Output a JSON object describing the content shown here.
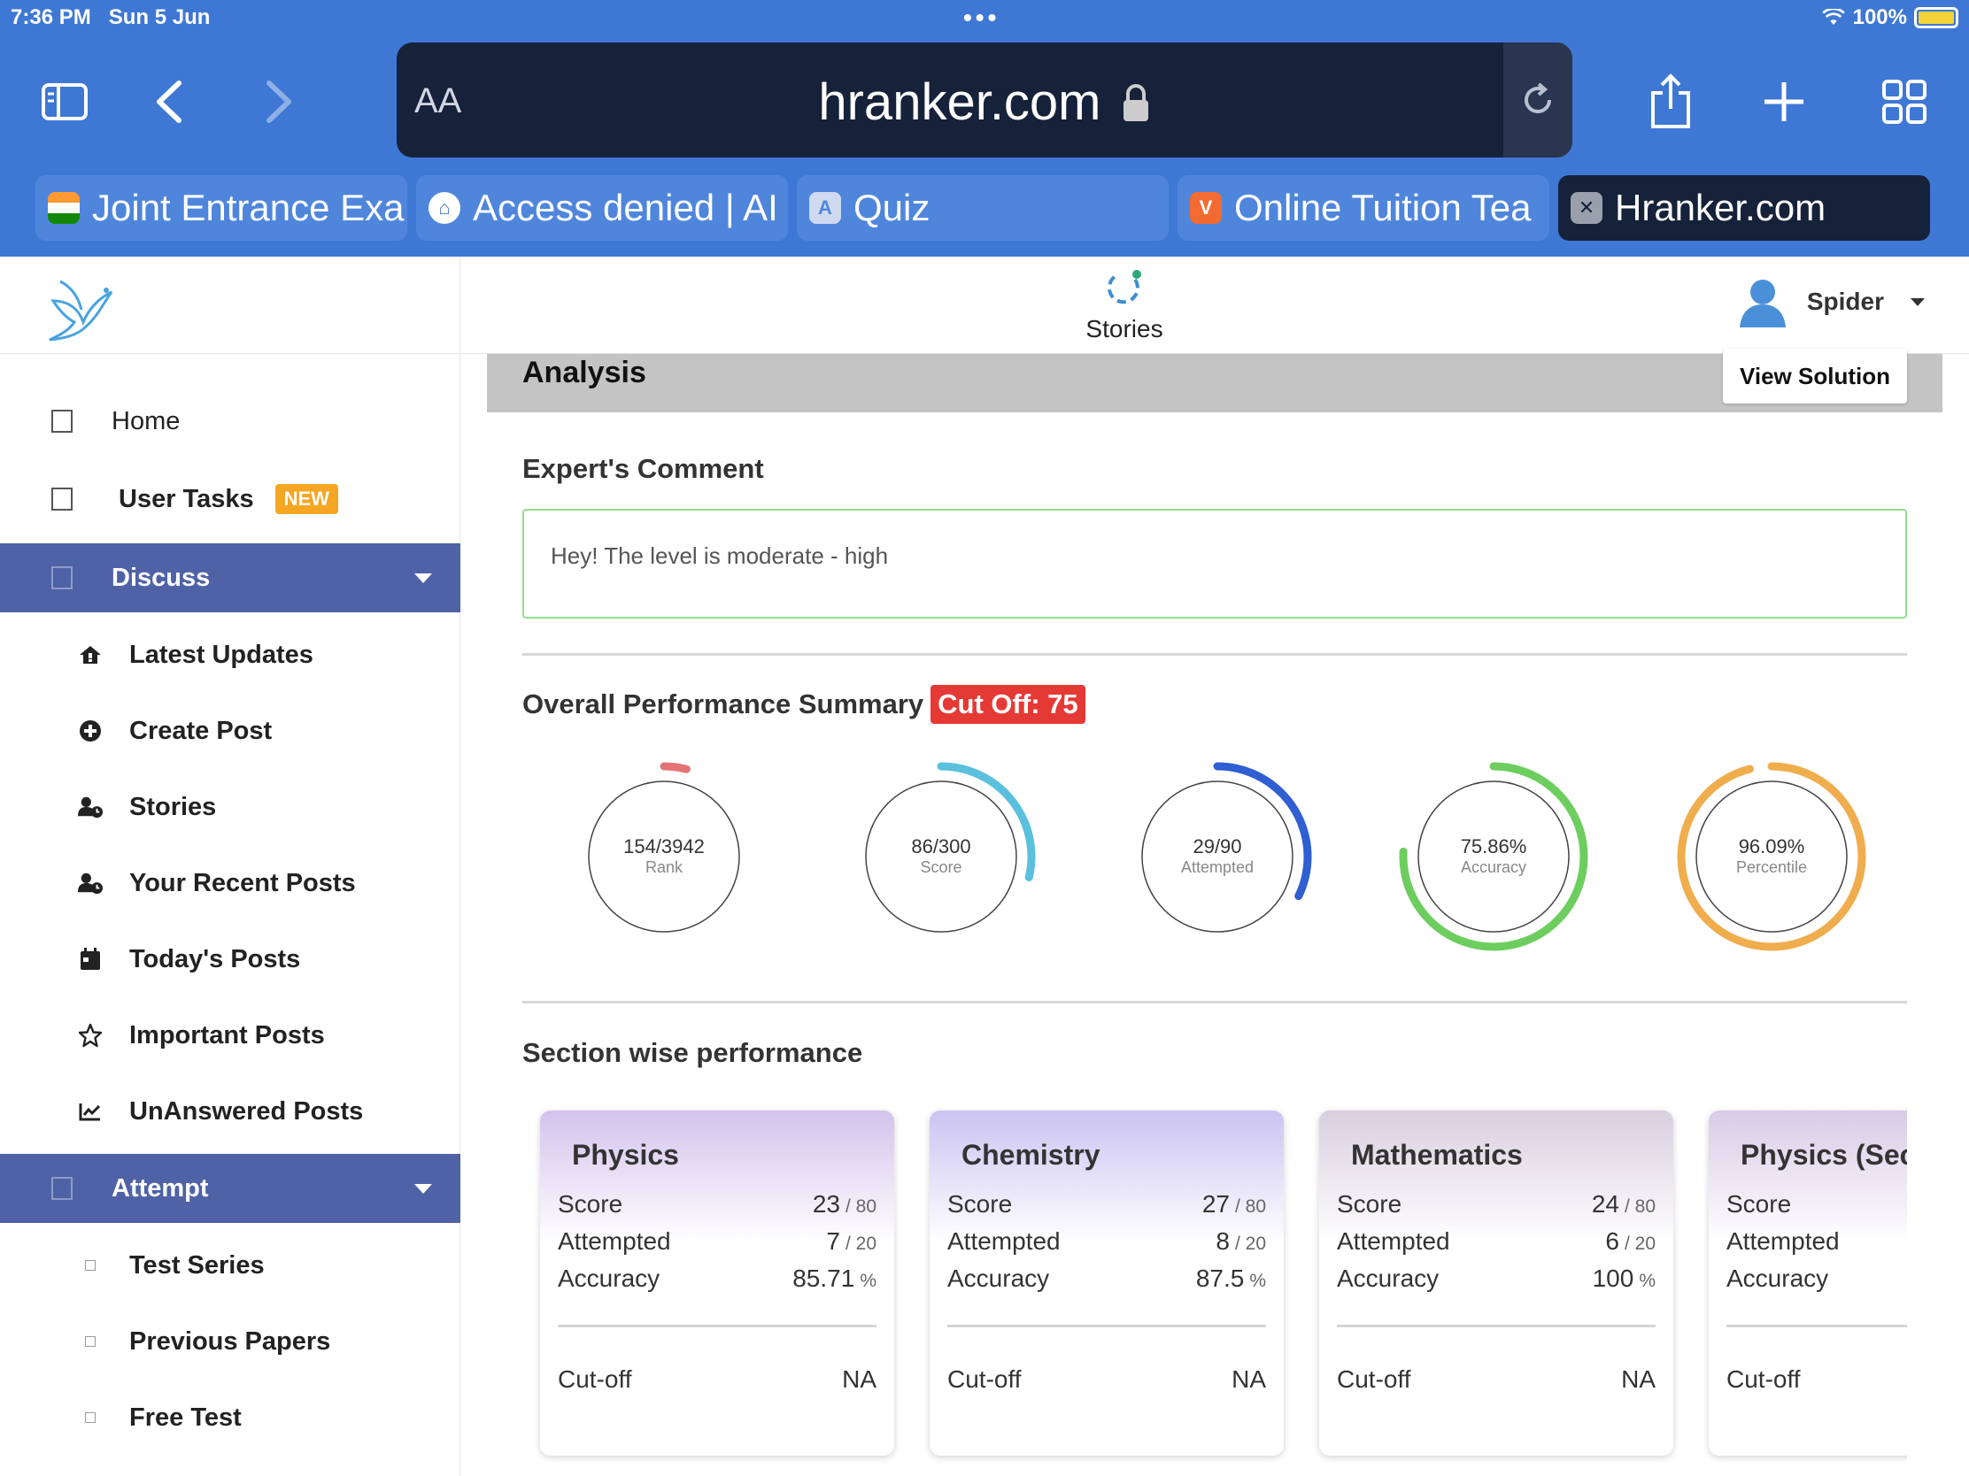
{
  "status_bar": {
    "time": "7:36 PM",
    "date": "Sun 5 Jun",
    "battery": "100%"
  },
  "browser": {
    "reader_label": "AA",
    "url": "hranker.com",
    "tabs": [
      {
        "title": "Joint Entrance Exa",
        "icon": "india-flag-icon"
      },
      {
        "title": "Access denied | AI",
        "icon": "globe-icon"
      },
      {
        "title": "Quiz",
        "icon": "quiz-icon"
      },
      {
        "title": "Online Tuition Tea",
        "icon": "vedantu-icon"
      },
      {
        "title": "Hranker.com",
        "icon": "close-icon",
        "active": true
      }
    ]
  },
  "header": {
    "stories_label": "Stories",
    "user_name": "Spider"
  },
  "sidebar": {
    "home": "Home",
    "user_tasks": "User Tasks",
    "new_badge": "NEW",
    "discuss": "Discuss",
    "discuss_items": [
      "Latest Updates",
      "Create Post",
      "Stories",
      "Your Recent Posts",
      "Today's Posts",
      "Important Posts",
      "UnAnswered Posts"
    ],
    "attempt": "Attempt",
    "attempt_items": [
      "Test Series",
      "Previous Papers",
      "Free Test"
    ]
  },
  "main": {
    "analysis_title": "Analysis",
    "view_solution": "View Solution",
    "expert_heading": "Expert's Comment",
    "expert_comment": "Hey! The level is moderate - high",
    "summary_heading": "Overall Performance Summary",
    "cutoff_badge": "Cut Off: 75",
    "gauges": [
      {
        "value": "154/3942",
        "label": "Rank",
        "fraction": 0.04,
        "color": "#e57373"
      },
      {
        "value": "86/300",
        "label": "Score",
        "fraction": 0.287,
        "color": "#5bc0de"
      },
      {
        "value": "29/90",
        "label": "Attempted",
        "fraction": 0.322,
        "color": "#2f5fd0"
      },
      {
        "value": "75.86%",
        "label": "Accuracy",
        "fraction": 0.7586,
        "color": "#6dce5f"
      },
      {
        "value": "96.09%",
        "label": "Percentile",
        "fraction": 0.9609,
        "color": "#f0ad4e"
      }
    ],
    "section_heading": "Section wise performance",
    "sections": [
      {
        "name": "Physics",
        "score": "23",
        "score_total": "/ 80",
        "attempted": "7",
        "attempted_total": "/ 20",
        "accuracy": "85.71",
        "acc_unit": "%",
        "cutoff": "NA",
        "gradient": "#d3c3ec"
      },
      {
        "name": "Chemistry",
        "score": "27",
        "score_total": "/ 80",
        "attempted": "8",
        "attempted_total": "/ 20",
        "accuracy": "87.5",
        "acc_unit": "%",
        "cutoff": "NA",
        "gradient": "#cbc3f2"
      },
      {
        "name": "Mathematics",
        "score": "24",
        "score_total": "/ 80",
        "attempted": "6",
        "attempted_total": "/ 20",
        "accuracy": "100",
        "acc_unit": "%",
        "cutoff": "NA",
        "gradient": "#d9cfe0"
      },
      {
        "name": "Physics (Sec",
        "score": "",
        "score_total": "",
        "attempted": "",
        "attempted_total": "",
        "accuracy": "",
        "acc_unit": "",
        "cutoff": "",
        "gradient": "#d8cce6"
      }
    ],
    "row_labels": {
      "score": "Score",
      "attempted": "Attempted",
      "accuracy": "Accuracy",
      "cutoff": "Cut-off"
    }
  }
}
